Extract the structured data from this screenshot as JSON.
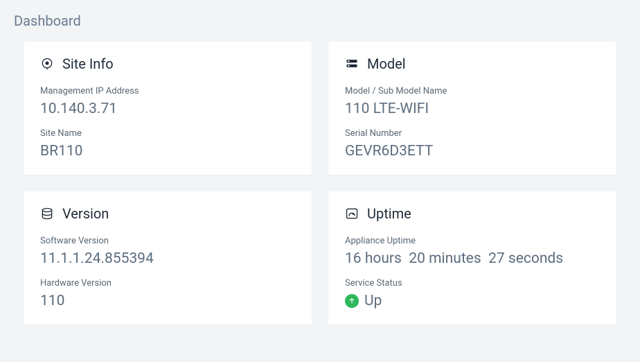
{
  "pageTitle": "Dashboard",
  "cards": {
    "siteInfo": {
      "title": "Site Info",
      "managementIpLabel": "Management IP Address",
      "managementIpValue": "10.140.3.71",
      "siteNameLabel": "Site Name",
      "siteNameValue": "BR110"
    },
    "model": {
      "title": "Model",
      "modelNameLabel": "Model / Sub Model Name",
      "modelNameValue": "110 LTE-WIFI",
      "serialLabel": "Serial Number",
      "serialValue": "GEVR6D3ETT"
    },
    "version": {
      "title": "Version",
      "softwareLabel": "Software Version",
      "softwareValue": "11.1.1.24.855394",
      "hardwareLabel": "Hardware Version",
      "hardwareValue": "110"
    },
    "uptime": {
      "title": "Uptime",
      "uptimeLabel": "Appliance Uptime",
      "uptimeValue": "16 hours  20 minutes  27 seconds",
      "statusLabel": "Service Status",
      "statusValue": "Up"
    }
  }
}
